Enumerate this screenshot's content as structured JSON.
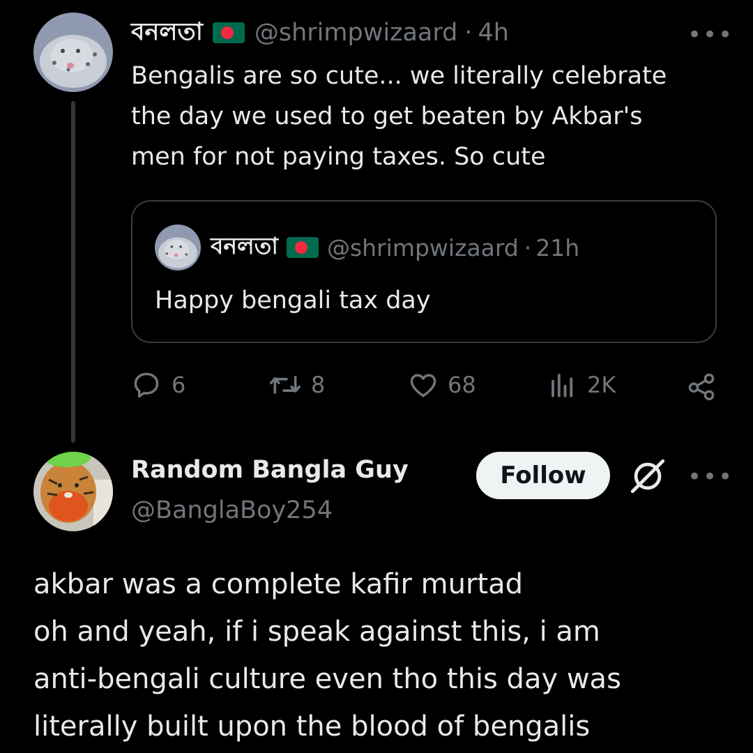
{
  "main_tweet": {
    "display_name": "বনলতা",
    "handle": "@shrimpwizaard",
    "separator": "·",
    "time": "4h",
    "lines": [
      "Bengalis are so cute... we literally celebrate",
      "the day we used to get beaten by Akbar's",
      "men for not paying taxes. So cute"
    ],
    "quoted": {
      "display_name": "বনলতা",
      "handle": "@shrimpwizaard",
      "separator": "·",
      "time": "21h",
      "text": "Happy bengali tax day"
    },
    "actions": {
      "replies": "6",
      "retweets": "8",
      "likes": "68",
      "views": "2K"
    },
    "more_label": "•••"
  },
  "reply": {
    "display_name": "Random Bangla Guy",
    "handle": "@BanglaBoy254",
    "follow_label": "Follow",
    "more_label": "•••",
    "lines": [
      "akbar was a complete kafir murtad",
      "oh and yeah, if i speak against this, i am",
      "anti-bengali culture even tho this day was",
      "literally built upon the blood of bengalis"
    ]
  },
  "icons": {
    "reply": "comment-bubble-icon",
    "retweet": "retweet-icon",
    "like": "heart-icon",
    "views": "bar-chart-icon",
    "share": "share-icon",
    "grok": "slash-circle-icon",
    "flag": "bangladesh-flag-icon"
  },
  "colors": {
    "background": "#000000",
    "text_primary": "#e7e9ea",
    "text_secondary": "#71767b",
    "border": "#3a3d40",
    "follow_bg": "#eff3f4",
    "flag_green": "#006a4e",
    "flag_red": "#f42a41"
  }
}
